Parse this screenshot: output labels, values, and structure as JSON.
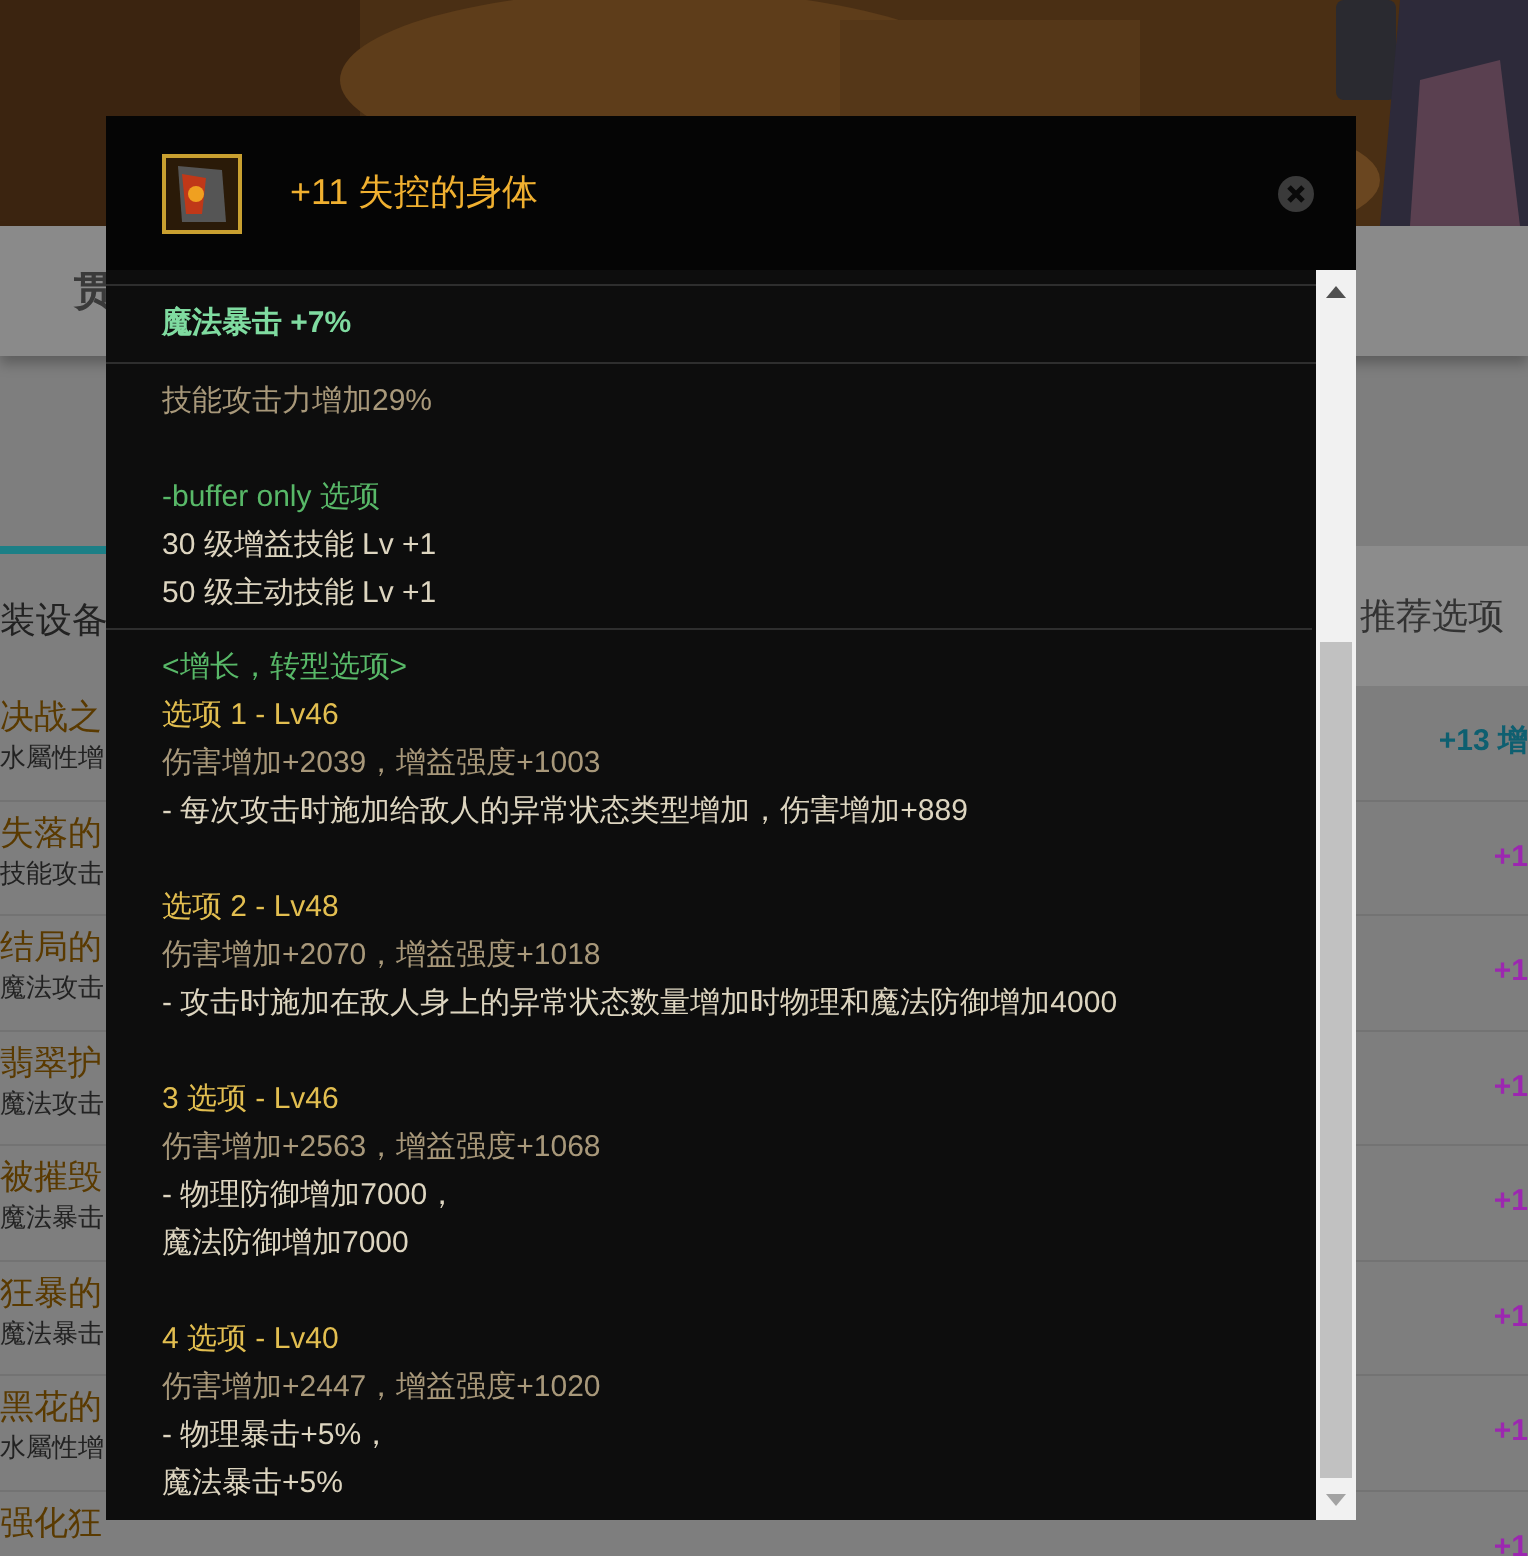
{
  "page": {
    "tab_fragment": "贯",
    "table_header_left": "装设备",
    "table_header_right": "推荐选项",
    "rows": [
      {
        "name": "决战之",
        "detail": "水屬性增",
        "option": "+13 增",
        "color": "#0e5f70"
      },
      {
        "name": "失落的",
        "detail": "技能攻击",
        "option": "+1",
        "color": "#9c27b0"
      },
      {
        "name": "结局的",
        "detail": "魔法攻击",
        "option": "+1",
        "color": "#9c27b0"
      },
      {
        "name": "翡翠护",
        "detail": "魔法攻击",
        "option": "+1",
        "color": "#9c27b0"
      },
      {
        "name": "被摧毁",
        "detail": "魔法暴击",
        "option": "+1",
        "color": "#9c27b0"
      },
      {
        "name": "狂暴的",
        "detail": "魔法暴击",
        "option": "+1",
        "color": "#9c27b0"
      },
      {
        "name": "黑花的",
        "detail": "水屬性增",
        "option": "+1",
        "color": "#9c27b0"
      },
      {
        "name": "强化狂",
        "detail": "",
        "option": "+1",
        "color": "#9c27b0"
      }
    ]
  },
  "tooltip": {
    "title": "+11 失控的身体",
    "main_stat": "魔法暴击 +7%",
    "description": "技能攻击力增加29%",
    "buffer_only": {
      "heading": "-buffer only 选项",
      "lines": [
        "30 级增益技能 Lv +1",
        "50 级主动技能 Lv +1"
      ]
    },
    "growth": {
      "heading": "<增长，转型选项>",
      "options": [
        {
          "title": "选项 1 - Lv46",
          "stats": "伤害增加+2039，增益强度+1003",
          "effects": [
            "- 每次攻击时施加给敌人的异常状态类型增加，伤害增加+889"
          ]
        },
        {
          "title": "选项 2 - Lv48",
          "stats": "伤害增加+2070，增益强度+1018",
          "effects": [
            "- 攻击时施加在敌人身上的异常状态数量增加时物理和魔法防御增加4000"
          ]
        },
        {
          "title": "3 选项 - Lv46",
          "stats": "伤害增加+2563，增益强度+1068",
          "effects": [
            "- 物理防御增加7000，",
            "魔法防御增加7000"
          ]
        },
        {
          "title": "4 选项 - Lv40",
          "stats": "伤害增加+2447，增益强度+1020",
          "effects": [
            "- 物理暴击+5%，",
            "魔法暴击+5%"
          ]
        }
      ]
    }
  }
}
